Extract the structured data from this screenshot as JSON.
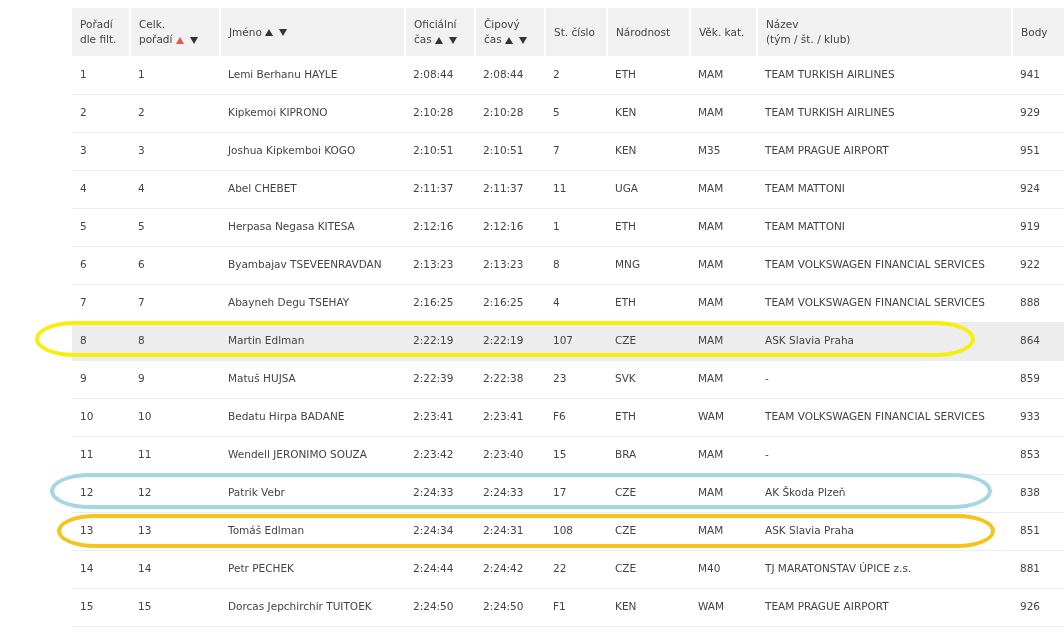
{
  "table": {
    "columns": [
      {
        "label": "Pořadí dle filt.",
        "sortable": false
      },
      {
        "label": "Celk. pořadí",
        "sortable": true,
        "sorted_ascending": true
      },
      {
        "label": "Jméno",
        "sortable": true,
        "sorted_ascending": false
      },
      {
        "label": "Oficiální čas",
        "sortable": true,
        "sorted_ascending": false
      },
      {
        "label": "Čipový čas",
        "sortable": true,
        "sorted_ascending": false
      },
      {
        "label": "St. číslo",
        "sortable": false
      },
      {
        "label": "Národnost",
        "sortable": false
      },
      {
        "label": "Věk. kat.",
        "sortable": false
      },
      {
        "label": "Název\n(tým / št. / klub)",
        "sortable": false
      },
      {
        "label": "Body",
        "sortable": false
      }
    ],
    "rows": [
      {
        "cells": [
          "1",
          "1",
          "Lemi Berhanu HAYLE",
          "2:08:44",
          "2:08:44",
          "2",
          "ETH",
          "MAM",
          "TEAM TURKISH AIRLINES",
          "941"
        ],
        "hovered": false
      },
      {
        "cells": [
          "2",
          "2",
          "Kipkemoi KIPRONO",
          "2:10:28",
          "2:10:28",
          "5",
          "KEN",
          "MAM",
          "TEAM TURKISH AIRLINES",
          "929"
        ],
        "hovered": false
      },
      {
        "cells": [
          "3",
          "3",
          "Joshua Kipkemboi KOGO",
          "2:10:51",
          "2:10:51",
          "7",
          "KEN",
          "M35",
          "TEAM PRAGUE AIRPORT",
          "951"
        ],
        "hovered": false
      },
      {
        "cells": [
          "4",
          "4",
          "Abel CHEBET",
          "2:11:37",
          "2:11:37",
          "11",
          "UGA",
          "MAM",
          "TEAM MATTONI",
          "924"
        ],
        "hovered": false
      },
      {
        "cells": [
          "5",
          "5",
          "Herpasa Negasa KITESA",
          "2:12:16",
          "2:12:16",
          "1",
          "ETH",
          "MAM",
          "TEAM MATTONI",
          "919"
        ],
        "hovered": false
      },
      {
        "cells": [
          "6",
          "6",
          "Byambajav TSEVEENRAVDAN",
          "2:13:23",
          "2:13:23",
          "8",
          "MNG",
          "MAM",
          "TEAM VOLKSWAGEN FINANCIAL SERVICES",
          "922"
        ],
        "hovered": false
      },
      {
        "cells": [
          "7",
          "7",
          "Abayneh Degu TSEHAY",
          "2:16:25",
          "2:16:25",
          "4",
          "ETH",
          "MAM",
          "TEAM VOLKSWAGEN FINANCIAL SERVICES",
          "888"
        ],
        "hovered": false
      },
      {
        "cells": [
          "8",
          "8",
          "Martin Edlman",
          "2:22:19",
          "2:22:19",
          "107",
          "CZE",
          "MAM",
          "ASK Slavia Praha",
          "864"
        ],
        "hovered": true,
        "color": "#f7ef0a"
      },
      {
        "cells": [
          "9",
          "9",
          "Matuš HUJSA",
          "2:22:39",
          "2:22:38",
          "23",
          "SVK",
          "MAM",
          "-",
          "859"
        ],
        "hovered": false
      },
      {
        "cells": [
          "10",
          "10",
          "Bedatu Hirpa BADANE",
          "2:23:41",
          "2:23:41",
          "F6",
          "ETH",
          "WAM",
          "TEAM VOLKSWAGEN FINANCIAL SERVICES",
          "933"
        ],
        "hovered": false
      },
      {
        "cells": [
          "11",
          "11",
          "Wendell JERONIMO SOUZA",
          "2:23:42",
          "2:23:40",
          "15",
          "BRA",
          "MAM",
          "-",
          "853"
        ],
        "hovered": false
      },
      {
        "cells": [
          "12",
          "12",
          "Patrik Vebr",
          "2:24:33",
          "2:24:33",
          "17",
          "CZE",
          "MAM",
          "AK Škoda Plzeň",
          "838"
        ],
        "hovered": false,
        "color": "#a4d6e4"
      },
      {
        "cells": [
          "13",
          "13",
          "Tomáš Edlman",
          "2:24:34",
          "2:24:31",
          "108",
          "CZE",
          "MAM",
          "ASK Slavia Praha",
          "851"
        ],
        "hovered": false,
        "color": "#f4c41c"
      },
      {
        "cells": [
          "14",
          "14",
          "Petr PECHEK",
          "2:24:44",
          "2:24:42",
          "22",
          "CZE",
          "M40",
          "TJ MARATONSTAV ÚPICE z.s.",
          "881"
        ],
        "hovered": false
      },
      {
        "cells": [
          "15",
          "15",
          "Dorcas Jepchirchir TUITOEK",
          "2:24:50",
          "2:24:50",
          "F1",
          "KEN",
          "WAM",
          "TEAM PRAGUE AIRPORT",
          "926"
        ],
        "hovered": false
      }
    ]
  }
}
